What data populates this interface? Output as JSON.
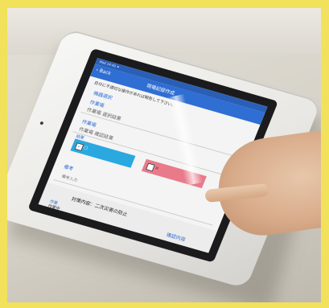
{
  "screen": {
    "status_text": "iPad 14:40 ⚫",
    "back_label": "‹ Back",
    "title": "現場記録作成",
    "warning": "自分に不適切な操作があれば報告して下さい。",
    "section1_label": "機器選択",
    "field_a_label": "作業場",
    "field_a_value": "作業場 選択結果",
    "field_b_label": "作業場",
    "field_b_value": "作業場 確認結果",
    "status_label": "結果",
    "check_label": "○",
    "cross_label": "×",
    "remarks_label": "備考",
    "remarks_placeholder": "備考入力",
    "section_header": "対策内容：二次災害の防止",
    "item1_label": "作業",
    "item1_value": "作業中",
    "item2_label": "確認内容"
  },
  "colors": {
    "frame": "#f2e15a",
    "navbar": "#2f6ed2",
    "check_button": "#2aa8e0",
    "cross_button": "#e87a8a"
  }
}
